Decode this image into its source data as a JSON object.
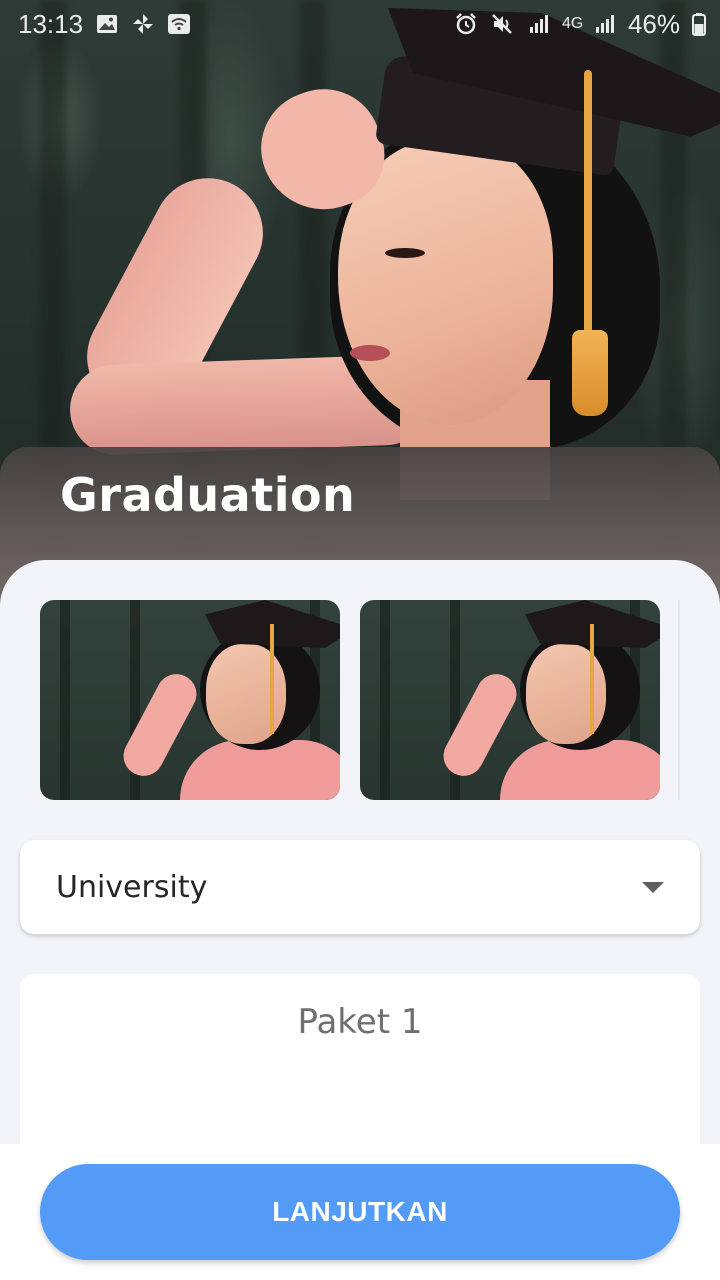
{
  "status_bar": {
    "time": "13:13",
    "network": "4G",
    "battery": "46%",
    "left_icons": [
      "image-icon",
      "pinwheel-icon",
      "wifi-icon"
    ],
    "right_icons": [
      "alarm-icon",
      "mute-icon",
      "signal-icon",
      "signal-icon",
      "battery-icon"
    ]
  },
  "hero": {
    "title": "Graduation",
    "image": "graduation-portrait"
  },
  "gallery": {
    "thumbnails": [
      "graduation-portrait",
      "graduation-portrait"
    ]
  },
  "category_select": {
    "selected": "University",
    "icon": "dropdown-arrow-icon"
  },
  "package": {
    "title": "Paket 1"
  },
  "footer": {
    "continue_label": "LANJUTKAN",
    "accent": "#539bf6"
  }
}
